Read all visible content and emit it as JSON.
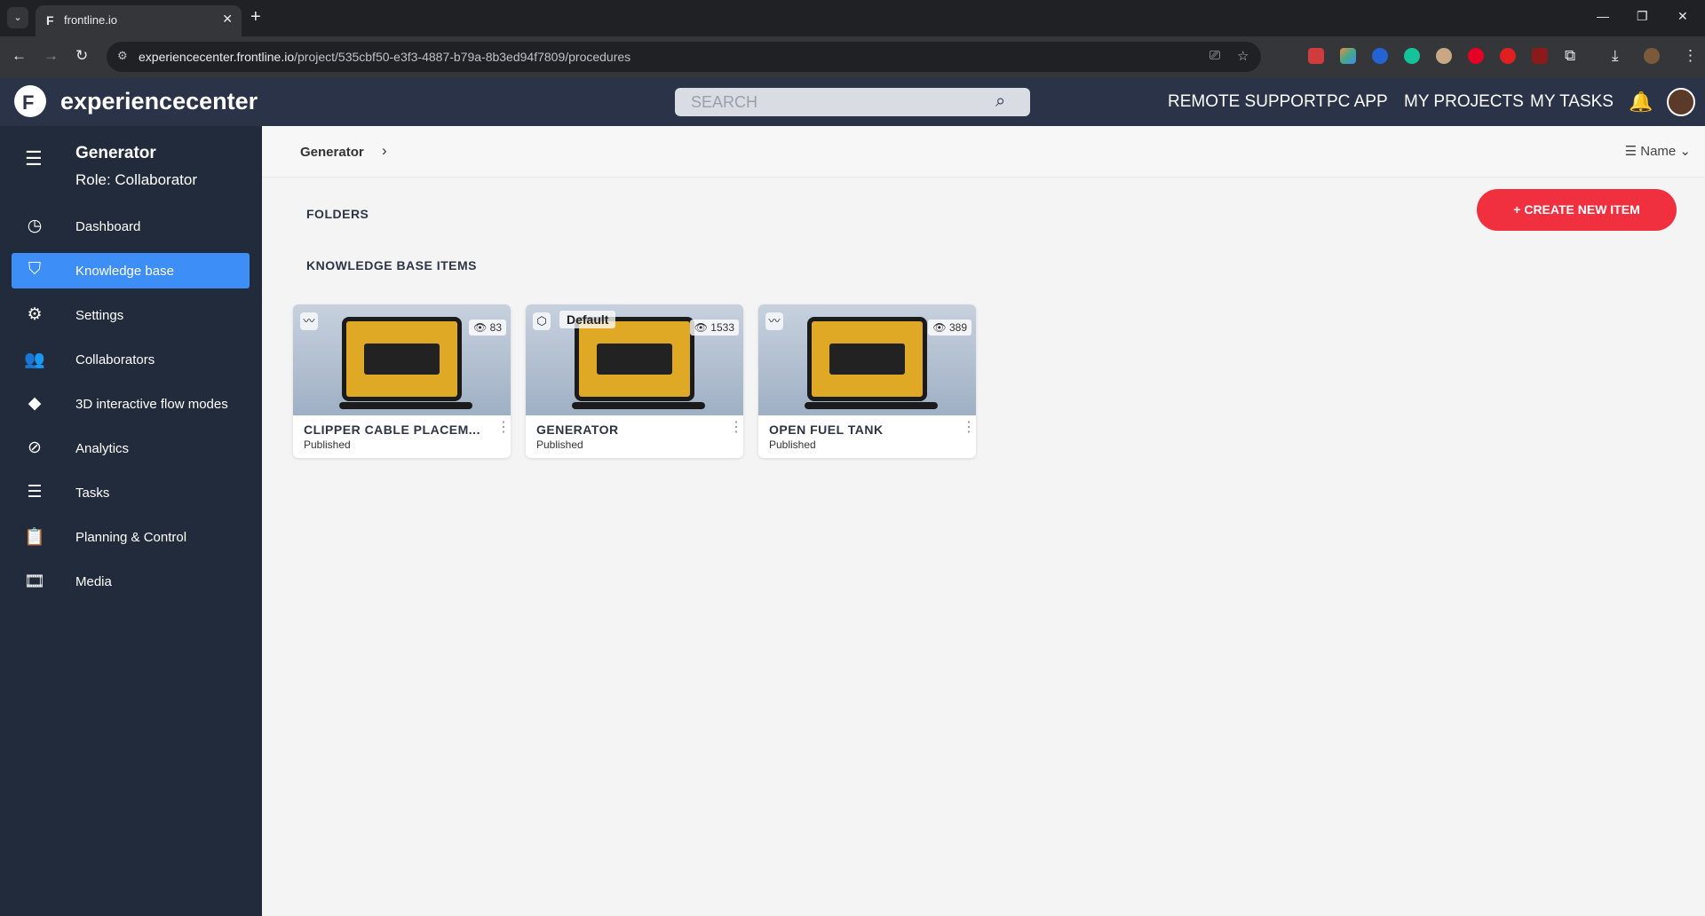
{
  "browser": {
    "tab_title": "frontline.io",
    "url_domain": "experiencecenter.frontline.io",
    "url_path": "/project/535cbf50-e3f3-4887-b79a-8b3ed94f7809/procedures"
  },
  "header": {
    "brand": "experiencecenter",
    "search_placeholder": "SEARCH",
    "nav": [
      "REMOTE SUPPORT",
      "PC APP",
      "MY PROJECTS",
      "MY TASKS"
    ]
  },
  "sidebar": {
    "project": "Generator",
    "role": "Role: Collaborator",
    "items": [
      {
        "label": "Dashboard",
        "icon": "gauge-icon",
        "glyph": "◷"
      },
      {
        "label": "Knowledge base",
        "icon": "book-reader-icon",
        "glyph": "⛉",
        "active": true
      },
      {
        "label": "Settings",
        "icon": "gear-icon",
        "glyph": "⚙"
      },
      {
        "label": "Collaborators",
        "icon": "people-icon",
        "glyph": "👥"
      },
      {
        "label": "3D interactive flow modes",
        "icon": "layers-icon",
        "glyph": "◆"
      },
      {
        "label": "Analytics",
        "icon": "analytics-icon",
        "glyph": "⊘"
      },
      {
        "label": "Tasks",
        "icon": "list-icon",
        "glyph": "☰"
      },
      {
        "label": "Planning & Control",
        "icon": "clipboard-icon",
        "glyph": "📋"
      },
      {
        "label": "Media",
        "icon": "film-icon",
        "glyph": "🎞"
      }
    ]
  },
  "main": {
    "breadcrumb": "Generator",
    "sort_label": "Name",
    "folders_heading": "FOLDERS",
    "items_heading": "KNOWLEDGE BASE ITEMS",
    "create_button": "+ CREATE NEW ITEM",
    "cards": [
      {
        "title": "CLIPPER CABLE PLACEM...",
        "status": "Published",
        "views": "83",
        "type_icon": "flow-icon",
        "badge": ""
      },
      {
        "title": "GENERATOR",
        "status": "Published",
        "views": "1533",
        "type_icon": "cube-icon",
        "badge": "Default"
      },
      {
        "title": "OPEN FUEL TANK",
        "status": "Published",
        "views": "389",
        "type_icon": "flow-icon",
        "badge": ""
      }
    ]
  }
}
